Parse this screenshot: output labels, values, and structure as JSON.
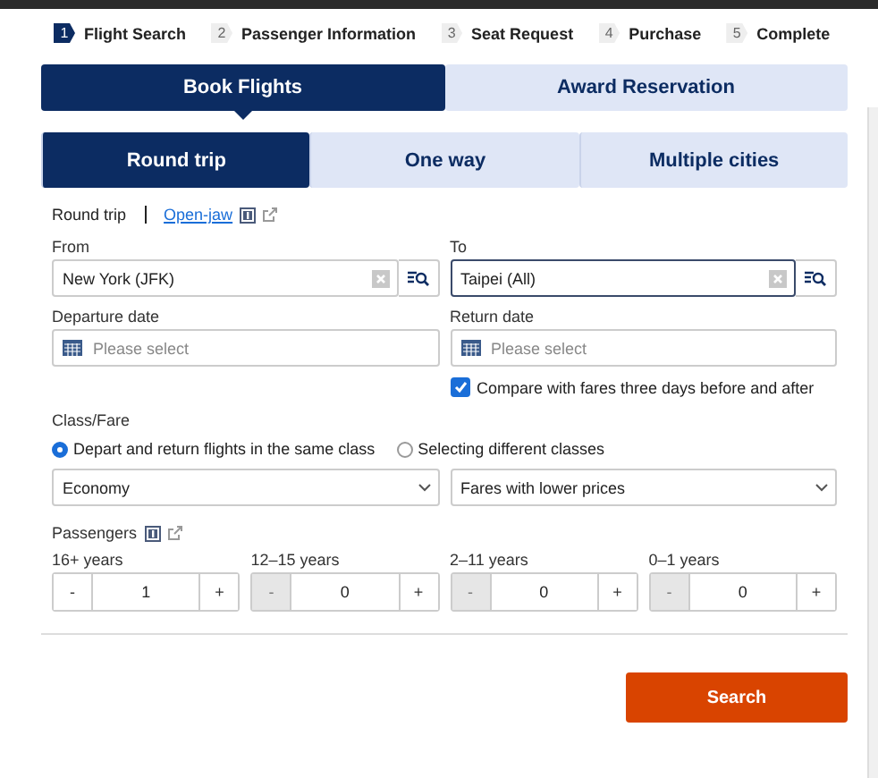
{
  "steps": [
    {
      "number": "1",
      "label": "Flight Search",
      "selected": true
    },
    {
      "number": "2",
      "label": "Passenger Information",
      "selected": false
    },
    {
      "number": "3",
      "label": "Seat Request",
      "selected": false
    },
    {
      "number": "4",
      "label": "Purchase",
      "selected": false
    },
    {
      "number": "5",
      "label": "Complete",
      "selected": false
    }
  ],
  "booking_tabs": [
    {
      "label": "Book Flights",
      "selected": true
    },
    {
      "label": "Award Reservation",
      "selected": false
    }
  ],
  "trip_tabs": [
    {
      "label": "Round trip",
      "selected": true
    },
    {
      "label": "One way",
      "selected": false
    },
    {
      "label": "Multiple cities",
      "selected": false
    }
  ],
  "route_type": {
    "label": "Round trip",
    "link": "Open-jaw"
  },
  "from": {
    "label": "From",
    "value": "New York (JFK)",
    "focused": false
  },
  "to": {
    "label": "To",
    "value": "Taipei (All)",
    "focused": true
  },
  "departure_date": {
    "label": "Departure date",
    "placeholder": "Please select"
  },
  "return_date": {
    "label": "Return date",
    "placeholder": "Please select"
  },
  "compare": {
    "label": "Compare with fares three days before and after",
    "checked": true
  },
  "class_fare": {
    "label": "Class/Fare",
    "options": [
      {
        "label": "Depart and return flights in the same class",
        "selected": true
      },
      {
        "label": "Selecting different classes",
        "selected": false
      }
    ],
    "cabin": "Economy",
    "fare": "Fares with lower prices"
  },
  "passengers": {
    "label": "Passengers",
    "groups": [
      {
        "label": "16+ years",
        "count": "1",
        "minus_disabled": false
      },
      {
        "label": "12–15 years",
        "count": "0",
        "minus_disabled": true
      },
      {
        "label": "2–11 years",
        "count": "0",
        "minus_disabled": true
      },
      {
        "label": "0–1 years",
        "count": "0",
        "minus_disabled": true
      }
    ],
    "minus": "-",
    "plus": "+"
  },
  "search_button": "Search"
}
